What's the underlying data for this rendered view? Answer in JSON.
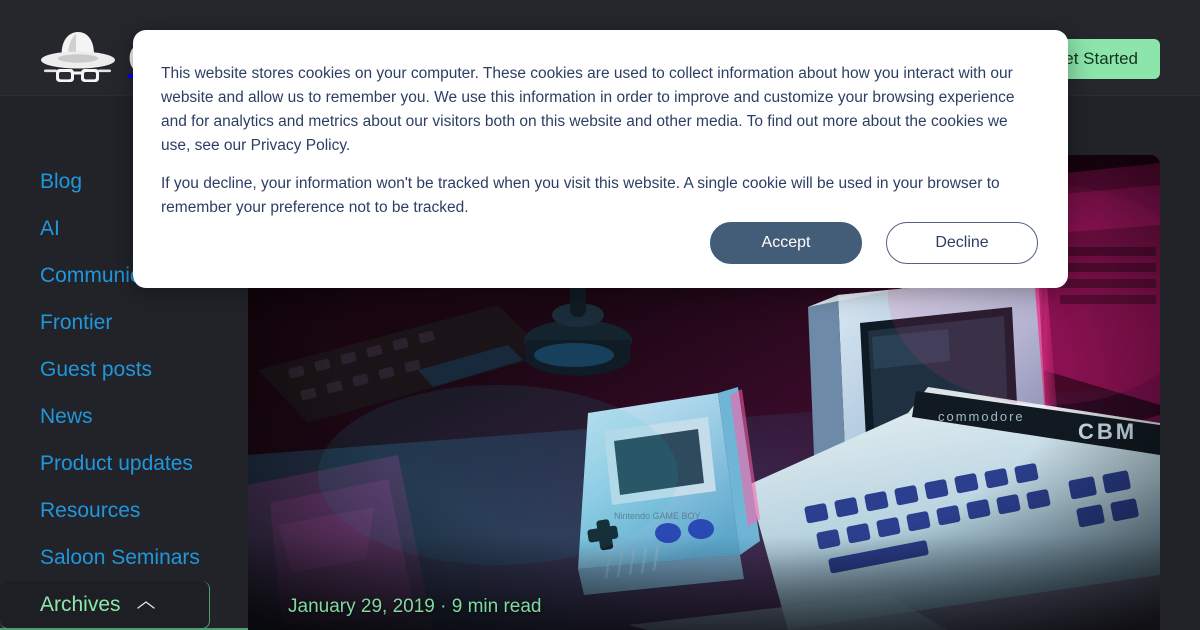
{
  "header": {
    "brand_name": "Gruntwork",
    "logo_icon": "cowboy-hat-sunglasses-icon",
    "cta_label": "Get Started"
  },
  "sidebar": {
    "items": [
      {
        "label": "Blog",
        "active": false
      },
      {
        "label": "AI",
        "active": false
      },
      {
        "label": "Communications",
        "active": false
      },
      {
        "label": "Frontier",
        "active": false
      },
      {
        "label": "Guest posts",
        "active": false
      },
      {
        "label": "News",
        "active": false
      },
      {
        "label": "Product updates",
        "active": false
      },
      {
        "label": "Resources",
        "active": false
      },
      {
        "label": "Saloon Seminars",
        "active": false
      },
      {
        "label": "Archives",
        "active": true,
        "icon": "chevron-up-icon"
      }
    ]
  },
  "main": {
    "hero": {
      "image_description": "retro computing desk scene lit with neon pink and blue light: Nintendo Game Boy, Commodore CBM computer with keyboard, mechanical keyboards and a joystick",
      "date": "January 29, 2019",
      "separator": "·",
      "read_time": "9 min read",
      "meta_line": "January 29, 2019 · 9 min read"
    }
  },
  "cookie_banner": {
    "paragraph_1": "This website stores cookies on your computer. These cookies are used to collect information about how you interact with our website and allow us to remember you. We use this information in order to improve and customize your browsing experience and for analytics and metrics about our visitors both on this website and other media. To find out more about the cookies we use, see our Privacy Policy.",
    "paragraph_2": "If you decline, your information won't be tracked when you visit this website. A single cookie will be used in your browser to remember your preference not to be tracked.",
    "accept_label": "Accept",
    "decline_label": "Decline"
  },
  "colors": {
    "page_background": "#212329",
    "header_background": "#25272d",
    "nav_link": "#2196dd",
    "accent_green": "#8ce6ab",
    "accent_green_border": "#4f9e6d",
    "cta_text": "#14331f",
    "modal_background": "#ffffff",
    "modal_text": "#2c3e63",
    "accept_button": "#435c78",
    "decline_border": "#51627e"
  }
}
